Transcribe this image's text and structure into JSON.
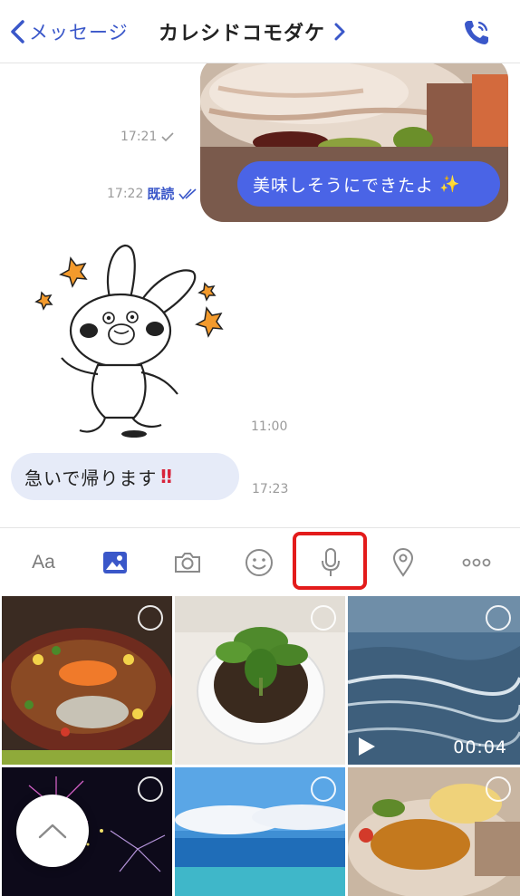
{
  "header": {
    "back_label": "メッセージ",
    "title": "カレシドコモダケ"
  },
  "messages": {
    "photo_time": "17:21",
    "outgoing_time": "17:22",
    "read_label": "既読",
    "outgoing_text": "美味しそうにできたよ",
    "outgoing_emoji": "✨",
    "sticker_time": "11:00",
    "incoming_text": "急いで帰ります",
    "incoming_emoji": "‼",
    "incoming_time": "17:23"
  },
  "toolbar": {
    "text_mode_label": "Aa",
    "icons": [
      "text-mode",
      "photo-icon",
      "camera-icon",
      "emoji-icon",
      "mic-icon",
      "location-icon",
      "more-icon"
    ],
    "highlighted": "mic-icon",
    "highlight_color": "#e31b1b"
  },
  "gallery": {
    "video_duration": "00:04"
  },
  "colors": {
    "accent": "#3a57c9",
    "outgoing_bubble": "#4a64e6",
    "incoming_bubble": "#e6ebf8"
  }
}
